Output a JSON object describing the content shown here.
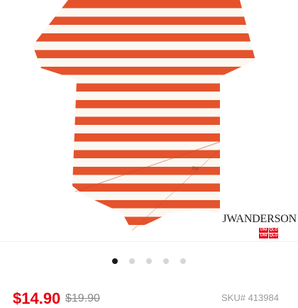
{
  "brand": {
    "designer_logo": "JWANDERSON",
    "store_logo": [
      "UNI",
      "QLO",
      "UNI",
      "QLO"
    ]
  },
  "product": {
    "image_icon": "striped-tshirt-image",
    "stripe_color": "#e4532c",
    "base_color": "#fbf8f2"
  },
  "carousel": {
    "total": 5,
    "active_index": 0
  },
  "pricing": {
    "price": "$14.90",
    "original_price": "$19.90",
    "sku": "SKU# 413984"
  },
  "colors": {
    "accent": "#e60012",
    "dot_active": "#1b1b1b",
    "dot_inactive": "#d6d6d6"
  }
}
